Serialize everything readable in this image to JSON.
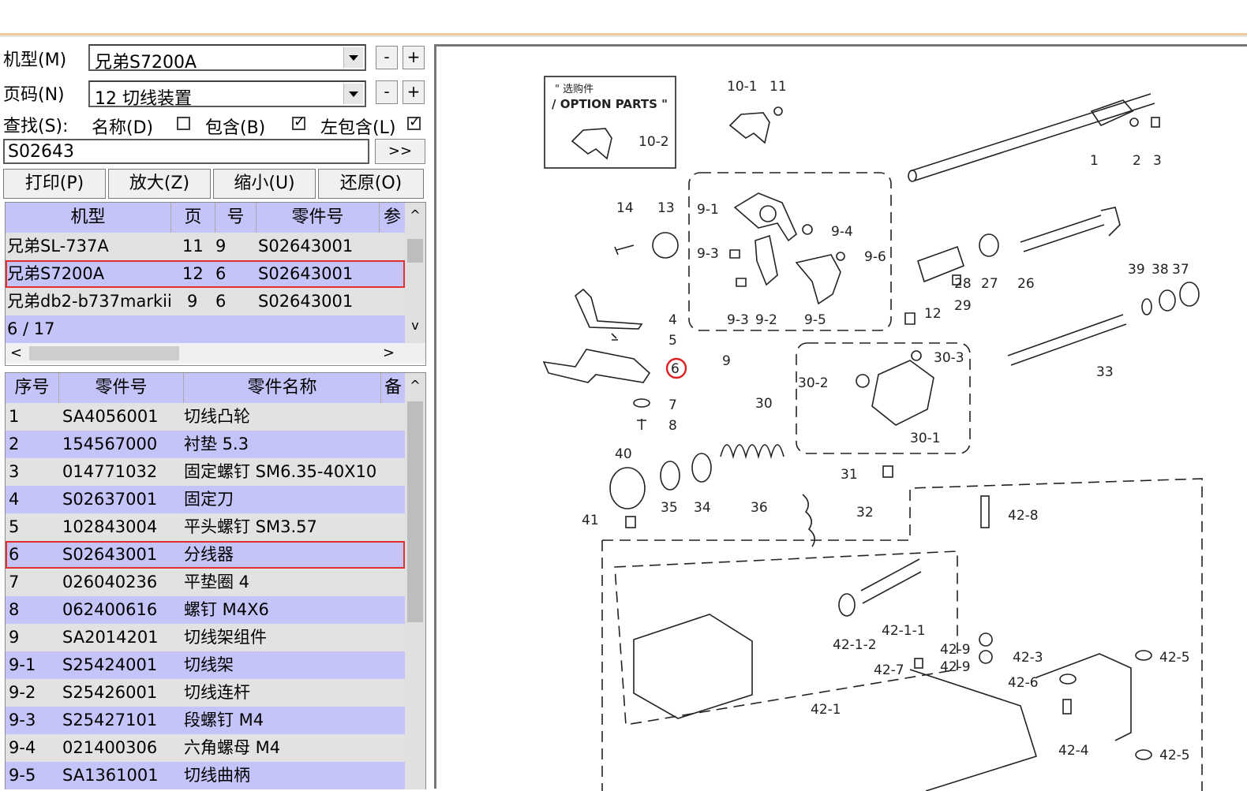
{
  "form": {
    "model_label": "机型(M)",
    "model_value": "兄弟S7200A",
    "page_label": "页码(N)",
    "page_value": "12 切线装置",
    "minus": "-",
    "plus": "+",
    "search_label": "查找(S):",
    "opt_name": "名称(D)",
    "opt_contain": "包含(B)",
    "opt_left": "左包含(L)",
    "search_value": "S02643",
    "go": ">>"
  },
  "toolbar": {
    "print": "打印(P)",
    "zoom_in": "放大(Z)",
    "zoom_out": "缩小(U)",
    "restore": "还原(O)"
  },
  "usage_table": {
    "headers": [
      "机型",
      "页",
      "号",
      "零件号",
      "参"
    ],
    "rows": [
      [
        "兄弟SL-737A",
        "11",
        "9",
        "S02643001"
      ],
      [
        "兄弟S7200A",
        "12",
        "6",
        "S02643001"
      ],
      [
        "兄弟db2-b737markii",
        "9",
        "6",
        "S02643001"
      ]
    ],
    "counter": "6 / 17",
    "scroll_left": "<",
    "scroll_right": ">"
  },
  "parts_table": {
    "headers": [
      "序号",
      "零件号",
      "零件名称",
      "备"
    ],
    "rows": [
      [
        "1",
        "SA4056001",
        "切线凸轮"
      ],
      [
        "2",
        "154567000",
        "衬垫 5.3"
      ],
      [
        "3",
        "014771032",
        "固定螺钉 SM6.35-40X10"
      ],
      [
        "4",
        "S02637001",
        "固定刀"
      ],
      [
        "5",
        "102843004",
        "平头螺钉 SM3.57"
      ],
      [
        "6",
        "S02643001",
        "分线器"
      ],
      [
        "7",
        "026040236",
        "平垫圈 4"
      ],
      [
        "8",
        "062400616",
        "螺钉 M4X6"
      ],
      [
        "9",
        "SA2014201",
        "切线架组件"
      ],
      [
        "9-1",
        "S25424001",
        "切线架"
      ],
      [
        "9-2",
        "S25426001",
        "切线连杆"
      ],
      [
        "9-3",
        "S25427101",
        "段螺钉 M4"
      ],
      [
        "9-4",
        "021400306",
        "六角螺母 M4"
      ],
      [
        "9-5",
        "SA1361001",
        "切线曲柄"
      ]
    ]
  },
  "diagram": {
    "option_title_1": "\" 选购件",
    "option_title_2": "/ OPTION PARTS \"",
    "labels": [
      "10-1",
      "11",
      "10-2",
      "1",
      "2",
      "3",
      "14",
      "13",
      "9-1",
      "9-4",
      "9-3",
      "9-6",
      "28",
      "27",
      "26",
      "29",
      "12",
      "9-3",
      "9-2",
      "9-5",
      "4",
      "5",
      "9",
      "39",
      "38",
      "37",
      "6",
      "30-3",
      "33",
      "30-2",
      "7",
      "8",
      "30",
      "30-1",
      "40",
      "31",
      "35",
      "34",
      "36",
      "32",
      "41",
      "42-8",
      "42-1-1",
      "42-1-2",
      "42-9",
      "42-9",
      "42-3",
      "42-5",
      "42-7",
      "42-6",
      "42-1",
      "42-4",
      "42-5"
    ],
    "highlight_color": "#e02020"
  },
  "colors": {
    "row_alt": "#c4c4f8",
    "row": "#e2e2e2",
    "select": "#e03030"
  }
}
